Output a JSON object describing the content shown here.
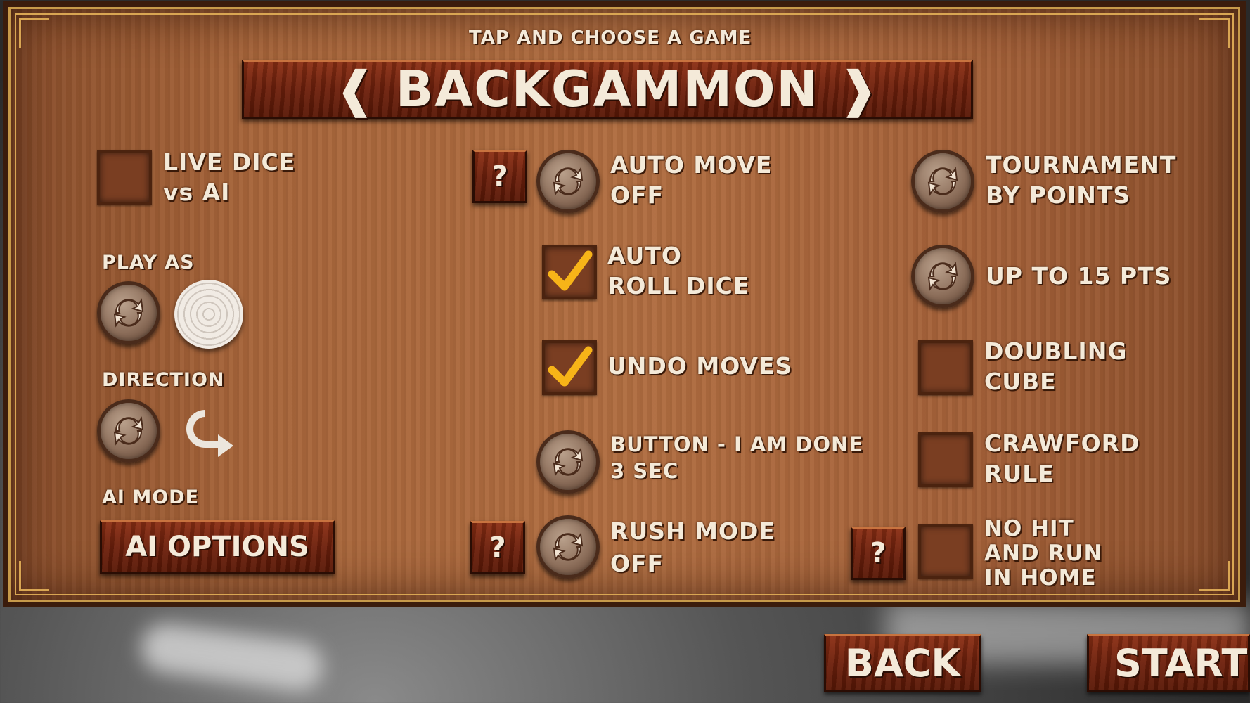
{
  "header": {
    "subtitle": "TAP AND CHOOSE A GAME",
    "game_title": "❰ BACKGAMMON ❱"
  },
  "left": {
    "live_dice": {
      "line1": "LIVE DICE",
      "line2": "vs AI",
      "checked": false
    },
    "play_as_label": "PLAY AS",
    "direction_label": "DIRECTION",
    "ai_mode_label": "AI MODE",
    "ai_options_button": "AI OPTIONS"
  },
  "middle": {
    "help_label": "?",
    "auto_move": {
      "line1": "AUTO MOVE",
      "line2": "OFF"
    },
    "auto_roll": {
      "line1": "AUTO",
      "line2": "ROLL DICE",
      "checked": true
    },
    "undo_moves": {
      "line1": "UNDO MOVES",
      "checked": true
    },
    "done_button": {
      "line1": "BUTTON - I AM DONE",
      "line2": "3 SEC"
    },
    "rush_mode": {
      "line1": "RUSH MODE",
      "line2": "OFF"
    }
  },
  "right": {
    "tournament": {
      "line1": "TOURNAMENT",
      "line2": "BY POINTS"
    },
    "points": {
      "line1": "UP TO 15 PTS"
    },
    "doubling_cube": {
      "line1": "DOUBLING",
      "line2": "CUBE",
      "checked": false
    },
    "crawford": {
      "line1": "CRAWFORD",
      "line2": "RULE",
      "checked": false
    },
    "no_hit": {
      "line1": "NO HIT",
      "line2": "AND RUN",
      "line3": "IN HOME",
      "checked": false
    }
  },
  "footer": {
    "back_label": "BACK",
    "start_label": "START"
  },
  "colors": {
    "wood": "#a7653a",
    "button_wood": "#6e200c",
    "check": "#f7b418",
    "text": "#f4ead9"
  },
  "icons": {
    "cycle": "refresh-cycle-icon",
    "check": "checkmark-icon",
    "direction": "curved-arrow-icon",
    "piece": "white-checker-piece"
  }
}
